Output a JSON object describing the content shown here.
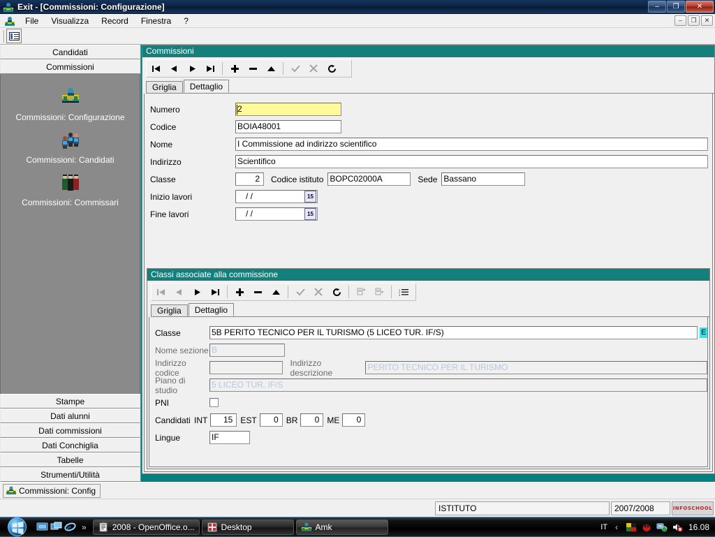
{
  "window": {
    "title": "Exit - [Commissioni: Configurazione]",
    "app_icon": "app-icon",
    "minimize": "–",
    "maximize": "❐",
    "close": "✕"
  },
  "menubar": {
    "icon": "mdi-app-icon",
    "items": [
      "File",
      "Visualizza",
      "Record",
      "Finestra",
      "?"
    ],
    "mdi_restore": "–",
    "mdi_maximize": "❐",
    "mdi_close": "✕"
  },
  "apptoolbar": {
    "list_button": "list-view-icon"
  },
  "sidebar": {
    "top_buttons": [
      "Candidati",
      "Commissioni"
    ],
    "shortcuts": [
      {
        "label": "Commissioni: Configurazione",
        "icon": "commission-config-icon"
      },
      {
        "label": "Commissioni: Candidati",
        "icon": "commission-candidates-icon"
      },
      {
        "label": "Commissioni: Commissari",
        "icon": "commission-examiners-icon"
      }
    ],
    "bottom_buttons": [
      "Stampe",
      "Dati alunni",
      "Dati commissioni",
      "Dati Conchiglia",
      "Tabelle",
      "Strumenti/Utilità"
    ]
  },
  "commissioni_panel": {
    "caption": "Commissioni",
    "toolbar": [
      {
        "name": "first-record",
        "glyph": "⏮",
        "enabled": true
      },
      {
        "name": "prev-record",
        "glyph": "◀",
        "enabled": true
      },
      {
        "name": "next-record",
        "glyph": "▶",
        "enabled": true
      },
      {
        "name": "last-record",
        "glyph": "⏭",
        "enabled": true
      },
      {
        "name": "add-record",
        "glyph": "＋",
        "enabled": true
      },
      {
        "name": "delete-record",
        "glyph": "−",
        "enabled": true
      },
      {
        "name": "edit-record",
        "glyph": "▲",
        "enabled": true
      },
      {
        "name": "post-edit",
        "glyph": "✓",
        "enabled": false
      },
      {
        "name": "cancel-edit",
        "glyph": "✕",
        "enabled": false
      },
      {
        "name": "refresh",
        "glyph": "⟳",
        "enabled": true
      }
    ],
    "tabs": [
      {
        "label": "Griglia",
        "active": false
      },
      {
        "label": "Dettaglio",
        "active": true
      }
    ],
    "fields": {
      "numero_label": "Numero",
      "numero_value": "2",
      "codice_label": "Codice",
      "codice_value": "BOIA48001",
      "nome_label": "Nome",
      "nome_value": "I Commissione ad indirizzo scientifico",
      "indirizzo_label": "Indirizzo",
      "indirizzo_value": "Scientifico",
      "classe_label": "Classe",
      "classe_value": "2",
      "codice_istituto_label": "Codice istituto",
      "codice_istituto_value": "BOPC02000A",
      "sede_label": "Sede",
      "sede_value": "Bassano",
      "inizio_lavori_label": "Inizio lavori",
      "inizio_lavori_value": "/  /",
      "fine_lavori_label": "Fine lavori",
      "fine_lavori_value": "/  /",
      "date_picker_glyph": "15"
    }
  },
  "classi_panel": {
    "caption": "Classi associate alla commissione",
    "toolbar": [
      {
        "name": "first-record",
        "glyph": "⏮",
        "enabled": false
      },
      {
        "name": "prev-record",
        "glyph": "◀",
        "enabled": false
      },
      {
        "name": "next-record",
        "glyph": "▶",
        "enabled": true
      },
      {
        "name": "last-record",
        "glyph": "⏭",
        "enabled": true
      },
      {
        "name": "add-record",
        "glyph": "＋",
        "enabled": true
      },
      {
        "name": "delete-record",
        "glyph": "−",
        "enabled": true
      },
      {
        "name": "edit-record",
        "glyph": "▲",
        "enabled": true
      },
      {
        "name": "post-edit",
        "glyph": "✓",
        "enabled": false
      },
      {
        "name": "cancel-edit",
        "glyph": "✕",
        "enabled": false
      },
      {
        "name": "refresh",
        "glyph": "⟳",
        "enabled": true
      },
      {
        "name": "move-up",
        "glyph": "⬆",
        "enabled": false
      },
      {
        "name": "move-down",
        "glyph": "⬇",
        "enabled": false
      },
      {
        "name": "order-list",
        "glyph": "≣",
        "enabled": true
      }
    ],
    "tabs": [
      {
        "label": "Griglia",
        "active": false
      },
      {
        "label": "Dettaglio",
        "active": true
      }
    ],
    "fields": {
      "classe_label": "Classe",
      "classe_value": "5B PERITO TECNICO PER IL TURISMO (5 LICEO TUR. IF/S)",
      "classe_expand_glyph": "E",
      "nome_sezione_label": "Nome sezione",
      "nome_sezione_value": "B",
      "indirizzo_codice_label": "Indirizzo codice",
      "indirizzo_codice_value": "",
      "indirizzo_descrizione_label": "Indirizzo descrizione",
      "indirizzo_descrizione_value": "PERITO TECNICO PER IL TURISMO",
      "piano_di_studio_label": "Piano di studio",
      "piano_di_studio_value": "5 LICEO TUR. IF/S",
      "pni_label": "PNI",
      "pni_checked": false,
      "candidati_label": "Candidati",
      "int_label": "INT",
      "int_value": "15",
      "est_label": "EST",
      "est_value": "0",
      "br_label": "BR",
      "br_value": "0",
      "me_label": "ME",
      "me_value": "0",
      "lingue_label": "Lingue",
      "lingue_value": "IF"
    }
  },
  "mdi_taskstrip": {
    "buttons": [
      {
        "label": "Commissioni: Config",
        "icon": "commission-config-icon"
      }
    ]
  },
  "statusbar": {
    "istituto": "ISTITUTO",
    "anno": "2007/2008",
    "logo": "INFOSCHOOL"
  },
  "taskbar": {
    "start": "start-orb",
    "quicklaunch": [
      {
        "name": "show-desktop-icon"
      },
      {
        "name": "switch-windows-icon"
      },
      {
        "name": "internet-explorer-icon"
      }
    ],
    "chevron": "»",
    "tasks": [
      {
        "label": "2008 - OpenOffice.o...",
        "icon": "openoffice-icon"
      },
      {
        "label": "Desktop",
        "icon": "desktop-folder-icon"
      },
      {
        "label": "Amk",
        "icon": "amk-icon",
        "active": true
      }
    ],
    "tray": {
      "language": "IT",
      "chevron": "‹",
      "icons": [
        "language-bar-icon",
        "antivirus-icon",
        "network-icon",
        "volume-muted-icon"
      ],
      "clock": "16.08"
    }
  },
  "colors": {
    "panel_caption": "#14807c",
    "desktop": "#008080",
    "highlight_field": "#fdfa9b",
    "readonly_text": "#b9c7dd",
    "logo_red": "#e51515"
  }
}
